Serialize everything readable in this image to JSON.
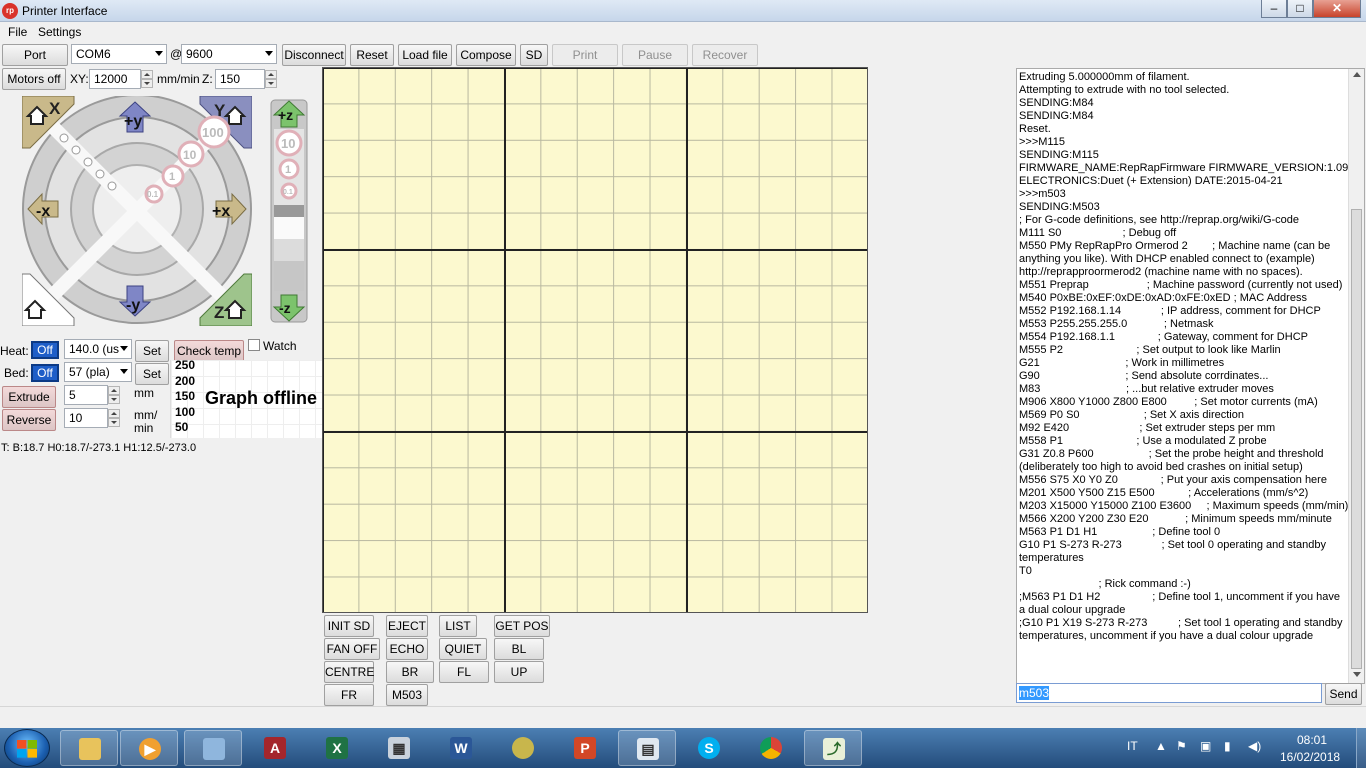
{
  "window": {
    "title": "Printer Interface",
    "app_icon": "rp"
  },
  "menu": [
    "File",
    "Settings"
  ],
  "toolbar": {
    "port_label": "Port",
    "port_value": "COM6",
    "at_sign": "@",
    "baud_value": "9600",
    "buttons": [
      "Disconnect",
      "Reset",
      "Load file",
      "Compose",
      "SD",
      "Print",
      "Pause",
      "Recover"
    ]
  },
  "motors": {
    "motors_off": "Motors off",
    "xy_label": "XY:",
    "xy_value": "12000",
    "xy_unit": "mm/min",
    "z_label": "Z:",
    "z_value": "150"
  },
  "jog": {
    "home_x": "X",
    "home_y": "Y",
    "home_z": "Z",
    "plus_y": "+y",
    "minus_y": "-y",
    "minus_x": "-x",
    "plus_x": "+x",
    "steps": [
      "100",
      "10",
      "1",
      "0.1"
    ],
    "plus_z": "+z",
    "minus_z": "-z",
    "z_steps": [
      "10",
      "1",
      "0.1"
    ]
  },
  "heat": {
    "heat_label": "Heat:",
    "heat_off": "Off",
    "heat_value": "140.0 (us",
    "set": "Set",
    "check_temp": "Check temp",
    "watch": "Watch",
    "bed_label": "Bed:",
    "bed_off": "Off",
    "bed_value": "57 (pla)",
    "bed_set": "Set"
  },
  "extrude": {
    "extrude": "Extrude",
    "extrude_value": "5",
    "mm": "mm",
    "reverse": "Reverse",
    "reverse_value": "10",
    "mm_per": "mm/",
    "min": "min"
  },
  "graph": {
    "ticks": [
      "250",
      "200",
      "150",
      "100",
      "50"
    ],
    "offline_text": "Graph offline"
  },
  "temps_line": "T: B:18.7 H0:18.7/-273.1 H1:12.5/-273.0",
  "macros": [
    [
      "INIT SD",
      "EJECT",
      "LIST",
      "GET POS"
    ],
    [
      "FAN OFF",
      "ECHO",
      "QUIET",
      "BL"
    ],
    [
      "CENTRE",
      "BR",
      "FL",
      "UP"
    ],
    [
      "FR",
      "M503"
    ]
  ],
  "log_text": "Extruding 5.000000mm of filament.\nAttempting to extrude with no tool selected.\nSENDING:M84\nSENDING:M84\nReset.\n>>>M115\nSENDING:M115\nFIRMWARE_NAME:RepRapFirmware FIRMWARE_VERSION:1.09\nELECTRONICS:Duet (+ Extension) DATE:2015-04-21\n>>>m503\nSENDING:M503\n; For G-code definitions, see http://reprap.org/wiki/G-code\nM111 S0                    ; Debug off\nM550 PMy RepRapPro Ormerod 2        ; Machine name (can be anything you like). With DHCP enabled connect to (example) http://reprapproormerod2 (machine name with no spaces).\nM551 Preprap                   ; Machine password (currently not used)\nM540 P0xBE:0xEF:0xDE:0xAD:0xFE:0xED ; MAC Address\nM552 P192.168.1.14             ; IP address, comment for DHCP\nM553 P255.255.255.0            ; Netmask\nM554 P192.168.1.1              ; Gateway, comment for DHCP\nM555 P2                        ; Set output to look like Marlin\nG21                            ; Work in millimetres\nG90                            ; Send absolute corrdinates...\nM83                            ; ...but relative extruder moves\nM906 X800 Y1000 Z800 E800         ; Set motor currents (mA)\nM569 P0 S0                     ; Set X axis direction\nM92 E420                       ; Set extruder steps per mm\nM558 P1                        ; Use a modulated Z probe\nG31 Z0.8 P600                  ; Set the probe height and threshold (deliberately too high to avoid bed crashes on initial setup)\nM556 S75 X0 Y0 Z0              ; Put your axis compensation here\nM201 X500 Y500 Z15 E500           ; Accelerations (mm/s^2)\nM203 X15000 Y15000 Z100 E3600     ; Maximum speeds (mm/min)\nM566 X200 Y200 Z30 E20            ; Minimum speeds mm/minute\nM563 P1 D1 H1                  ; Define tool 0\nG10 P1 S-273 R-273             ; Set tool 0 operating and standby temperatures\nT0\n                          ; Rick command :-)\n;M563 P1 D1 H2                 ; Define tool 1, uncomment if you have a dual colour upgrade\n;G10 P1 X19 S-273 R-273          ; Set tool 1 operating and standby temperatures, uncomment if you have a dual colour upgrade",
  "command": {
    "value": "m503",
    "send": "Send"
  },
  "taskbar": {
    "apps": [
      "explorer-icon",
      "media-icon",
      "paint-icon",
      "access-icon",
      "excel-icon",
      "calculator-icon",
      "word-icon",
      "app-icon",
      "powerpoint-icon",
      "window-icon",
      "skype-icon",
      "chrome-icon",
      "printer-app-icon"
    ],
    "lang": "IT",
    "time": "08:01",
    "date": "16/02/2018"
  }
}
